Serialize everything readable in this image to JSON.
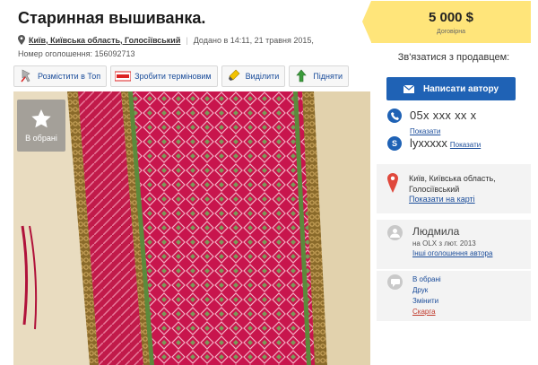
{
  "listing": {
    "title": "Старинная вышиванка.",
    "location_link": "Київ, Київська область, Голосіївський",
    "added": "Додано в 14:11, 21 травня 2015,",
    "ad_number": "Номер оголошення: 156092713",
    "favorite_label": "В обрані"
  },
  "actions": [
    {
      "label": "Розмістити в Топ",
      "icon": "pin-icon"
    },
    {
      "label": "Зробити терміновим",
      "icon": "urgent-icon"
    },
    {
      "label": "Виділити",
      "icon": "highlighter-icon"
    },
    {
      "label": "Підняти",
      "icon": "raise-icon"
    }
  ],
  "price": {
    "amount": "5 000 $",
    "note": "Договірна"
  },
  "contact": {
    "title": "Зв'язатися з продавцем:",
    "write_button": "Написати автору",
    "phone": "05x xxx xx x",
    "phone_show": "Показати",
    "skype": "lyxxxxx",
    "skype_show": "Показати"
  },
  "location": {
    "city_line1": "Київ, Київська область,",
    "city_line2": "Голосіївський",
    "map_link": "Показати на карті"
  },
  "seller": {
    "name": "Людмила",
    "since": "на OLX з лют. 2013",
    "other_ads": "Інші оголошення автора"
  },
  "links": {
    "favorites": "В обрані",
    "print": "Друк",
    "edit": "Змінити",
    "complain": "Скарга"
  },
  "colors": {
    "accent_blue": "#1f62b5",
    "price_bg": "#ffe57a",
    "link_blue": "#1a4c9a",
    "complain_red": "#c0392b"
  }
}
